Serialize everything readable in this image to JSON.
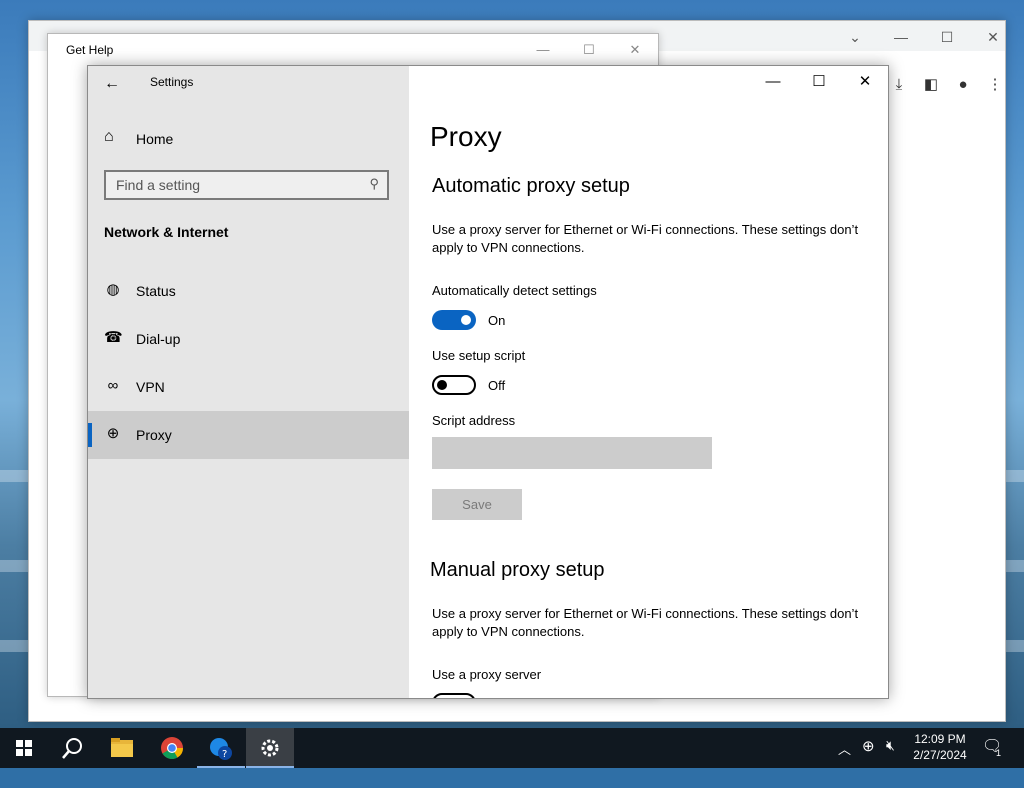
{
  "gethelp": {
    "title": "Get Help"
  },
  "settings": {
    "title": "Settings",
    "home_label": "Home",
    "search_placeholder": "Find a setting",
    "section_title": "Network & Internet",
    "nav": [
      {
        "label": "Status",
        "icon": "globe-status-icon"
      },
      {
        "label": "Dial-up",
        "icon": "dialup-icon"
      },
      {
        "label": "VPN",
        "icon": "vpn-icon"
      },
      {
        "label": "Proxy",
        "icon": "globe-icon",
        "selected": true
      }
    ],
    "page_title": "Proxy",
    "auto": {
      "heading": "Automatic proxy setup",
      "desc": "Use a proxy server for Ethernet or Wi-Fi connections. These settings don’t apply to VPN connections.",
      "detect_label": "Automatically detect settings",
      "detect_state": "On",
      "script_label": "Use setup script",
      "script_state": "Off",
      "address_label": "Script address",
      "address_value": "",
      "save_label": "Save"
    },
    "manual": {
      "heading": "Manual proxy setup",
      "desc": "Use a proxy server for Ethernet or Wi-Fi connections. These settings don’t apply to VPN connections.",
      "use_proxy_label": "Use a proxy server"
    }
  },
  "taskbar": {
    "time": "12:09 PM",
    "date": "2/27/2024",
    "notification_count": "1",
    "apps": [
      "start-icon",
      "search-icon",
      "file-explorer-icon",
      "chrome-icon",
      "get-help-icon",
      "settings-gear-icon"
    ]
  },
  "colors": {
    "accent": "#0a64c2",
    "sidebar": "#e6e6e6",
    "taskbar": "#101820"
  }
}
